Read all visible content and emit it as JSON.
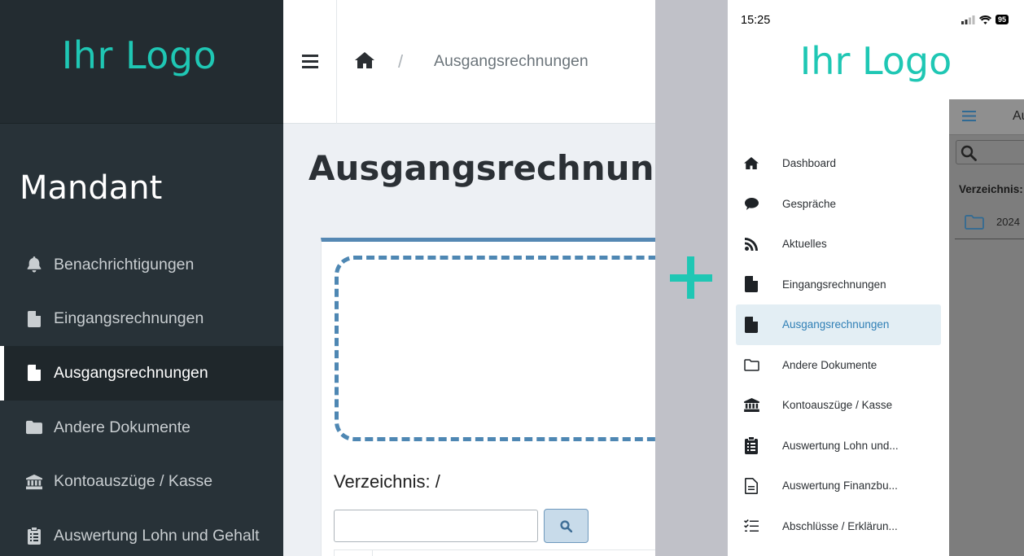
{
  "desktop": {
    "logo": "Ihr Logo",
    "mandant": "Mandant",
    "nav": [
      {
        "label": "Benachrichtigungen",
        "icon": "bell-icon"
      },
      {
        "label": "Eingangsrechnungen",
        "icon": "file-invoice-icon"
      },
      {
        "label": "Ausgangsrechnungen",
        "icon": "file-invoice-icon",
        "active": true
      },
      {
        "label": "Andere Dokumente",
        "icon": "folder-icon"
      },
      {
        "label": "Kontoauszüge / Kasse",
        "icon": "bank-icon"
      },
      {
        "label": "Auswertung Lohn und Gehalt",
        "icon": "clipboard-list-icon"
      }
    ],
    "breadcrumb": {
      "separator": "/",
      "current": "Ausgangsrechnungen"
    },
    "page_title": "Ausgangsrechnungen",
    "directory_label": "Verzeichnis: /",
    "search_value": ""
  },
  "mobile": {
    "status_time": "15:25",
    "battery": "95",
    "logo": "Ihr Logo",
    "nav": [
      {
        "label": "Dashboard",
        "icon": "home-icon"
      },
      {
        "label": "Gespräche",
        "icon": "chat-bubble-icon"
      },
      {
        "label": "Aktuelles",
        "icon": "rss-icon"
      },
      {
        "label": "Eingangsrechnungen",
        "icon": "file-invoice-icon"
      },
      {
        "label": "Ausgangsrechnungen",
        "icon": "file-invoice-icon",
        "active": true
      },
      {
        "label": "Andere Dokumente",
        "icon": "folder-outline-icon"
      },
      {
        "label": "Kontoauszüge / Kasse",
        "icon": "bank-icon"
      },
      {
        "label": "Auswertung Lohn und...",
        "icon": "clipboard-list-icon"
      },
      {
        "label": "Auswertung Finanzbu...",
        "icon": "file-text-icon"
      },
      {
        "label": "Abschlüsse / Erklärun...",
        "icon": "checklist-icon"
      }
    ],
    "appbar_title": "Au",
    "directory_label": "Verzeichnis:",
    "folder_name": "2024"
  },
  "colors": {
    "accent": "#1fc7b4",
    "sidebar": "#283238",
    "primary": "#4e87b3"
  }
}
